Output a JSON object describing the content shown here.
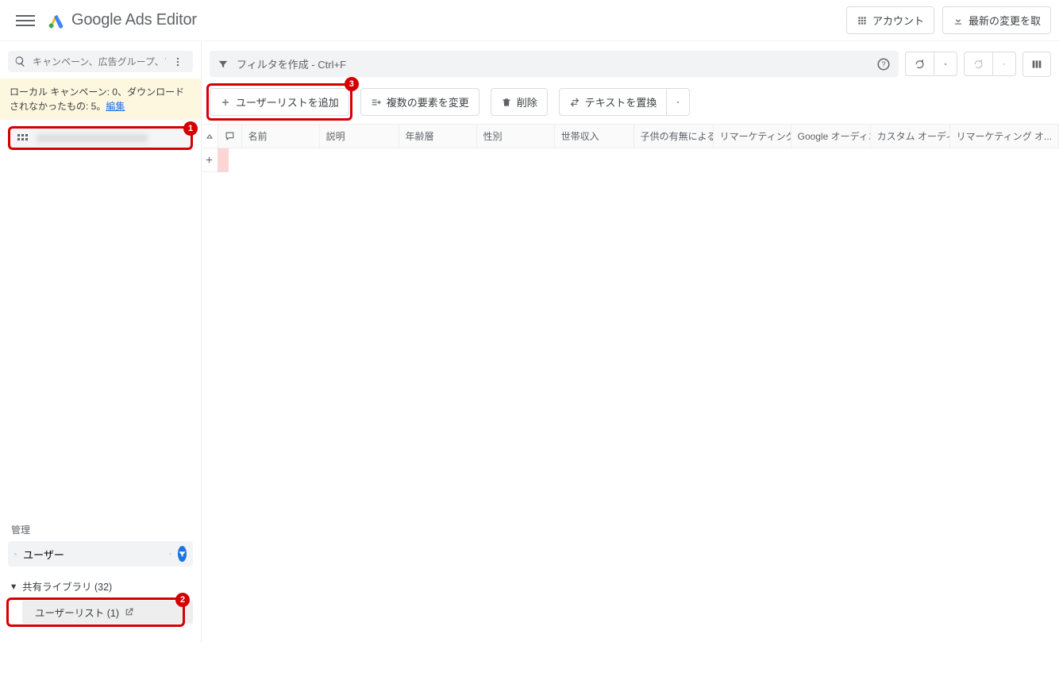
{
  "app": {
    "product": "Google",
    "name": "Ads Editor"
  },
  "topbar": {
    "account": "アカウント",
    "get_changes": "最新の変更を取"
  },
  "left": {
    "search_placeholder": "キャンペーン、広告グループ、アセ...",
    "notice_prefix": "ローカル キャンペーン: 0、ダウンロードされなかったもの: 5。",
    "notice_link": "編集"
  },
  "filter": {
    "placeholder": "フィルタを作成 - Ctrl+F"
  },
  "actions": {
    "add_user_list": "ユーザーリストを追加",
    "bulk_edit": "複数の要素を変更",
    "delete": "削除",
    "replace_text": "テキストを置換"
  },
  "badges": {
    "one": "1",
    "two": "2",
    "three": "3"
  },
  "mgmt": {
    "label": "管理",
    "search_value": "ユーザー",
    "tree_parent": "共有ライブラリ (32)",
    "tree_child": "ユーザーリスト (1)"
  },
  "columns": {
    "name": "名前",
    "description": "説明",
    "age": "年齢層",
    "gender": "性別",
    "income": "世帯収入",
    "children": "子供の有無による...",
    "remarketing": "リマーケティング オ...",
    "google_aud": "Google オーディエ...",
    "custom_aud": "カスタム オーディエ...",
    "remarketing2": "リマーケティング オ..."
  }
}
